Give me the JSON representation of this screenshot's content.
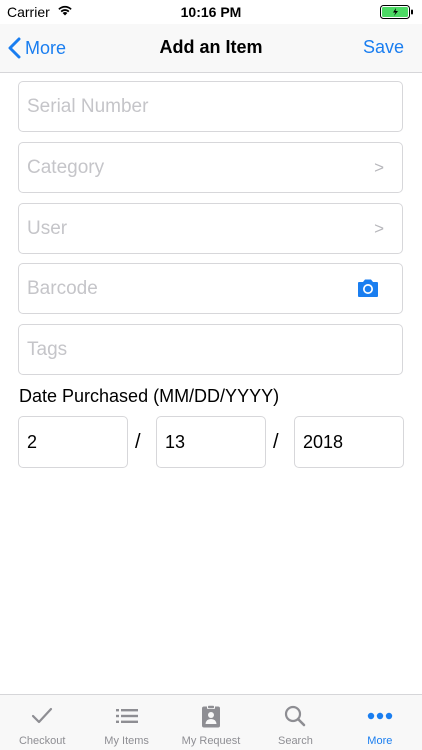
{
  "status_bar": {
    "carrier": "Carrier",
    "time": "10:16 PM"
  },
  "nav": {
    "back_label": "More",
    "title": "Add an Item",
    "save_label": "Save"
  },
  "form": {
    "serial_placeholder": "Serial Number",
    "category_placeholder": "Category",
    "user_placeholder": "User",
    "barcode_placeholder": "Barcode",
    "tags_placeholder": "Tags",
    "chevron": ">",
    "date_label": "Date Purchased (MM/DD/YYYY)",
    "date_separator": "/",
    "month": "2",
    "day": "13",
    "year": "2018"
  },
  "tabs": [
    {
      "label": "Checkout",
      "icon": "checkmark-icon"
    },
    {
      "label": "My Items",
      "icon": "list-icon"
    },
    {
      "label": "My Request",
      "icon": "clipboard-icon"
    },
    {
      "label": "Search",
      "icon": "search-icon"
    },
    {
      "label": "More",
      "icon": "more-icon"
    }
  ],
  "colors": {
    "accent": "#1a7ef0",
    "placeholder": "#c5c5c9",
    "inactive_tab": "#8e8e93",
    "battery": "#4cd964"
  }
}
